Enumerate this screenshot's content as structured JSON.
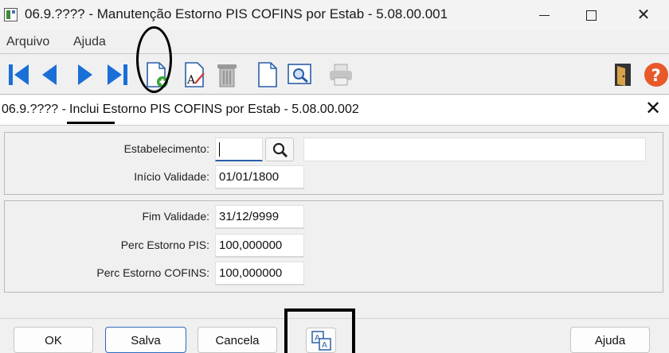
{
  "window": {
    "title": "06.9.???? - Manutenção Estorno PIS COFINS por Estab - 5.08.00.001"
  },
  "menu": {
    "items": [
      "Arquivo",
      "Ajuda"
    ]
  },
  "toolbar": {
    "icons": [
      "first-record-icon",
      "previous-record-icon",
      "next-record-icon",
      "last-record-icon",
      "add-record-icon",
      "edit-record-icon",
      "delete-icon",
      "blank-page-icon",
      "zoom-icon",
      "print-icon",
      "exit-icon",
      "help-icon"
    ]
  },
  "dialog": {
    "title_prefix": "06.9.???? -",
    "title_rest": "Inclui Estorno PIS COFINS  por Estab - 5.08.00.002"
  },
  "form": {
    "estabelecimento_label": "Estabelecimento:",
    "estabelecimento_value": "",
    "inicio_label": "Início Validade:",
    "inicio_value": "01/01/1800",
    "fim_label": "Fim Validade:",
    "fim_value": "31/12/9999",
    "pis_label": "Perc Estorno PIS:",
    "pis_value": "100,000000",
    "cofins_label": "Perc Estorno COFINS:",
    "cofins_value": "100,000000"
  },
  "buttons": {
    "ok": "OK",
    "salva": "Salva",
    "cancela": "Cancela",
    "ajuda": "Ajuda"
  },
  "colors": {
    "accent_blue": "#1a6fd6",
    "help_orange": "#e8592a",
    "add_green": "#3aa43a"
  }
}
